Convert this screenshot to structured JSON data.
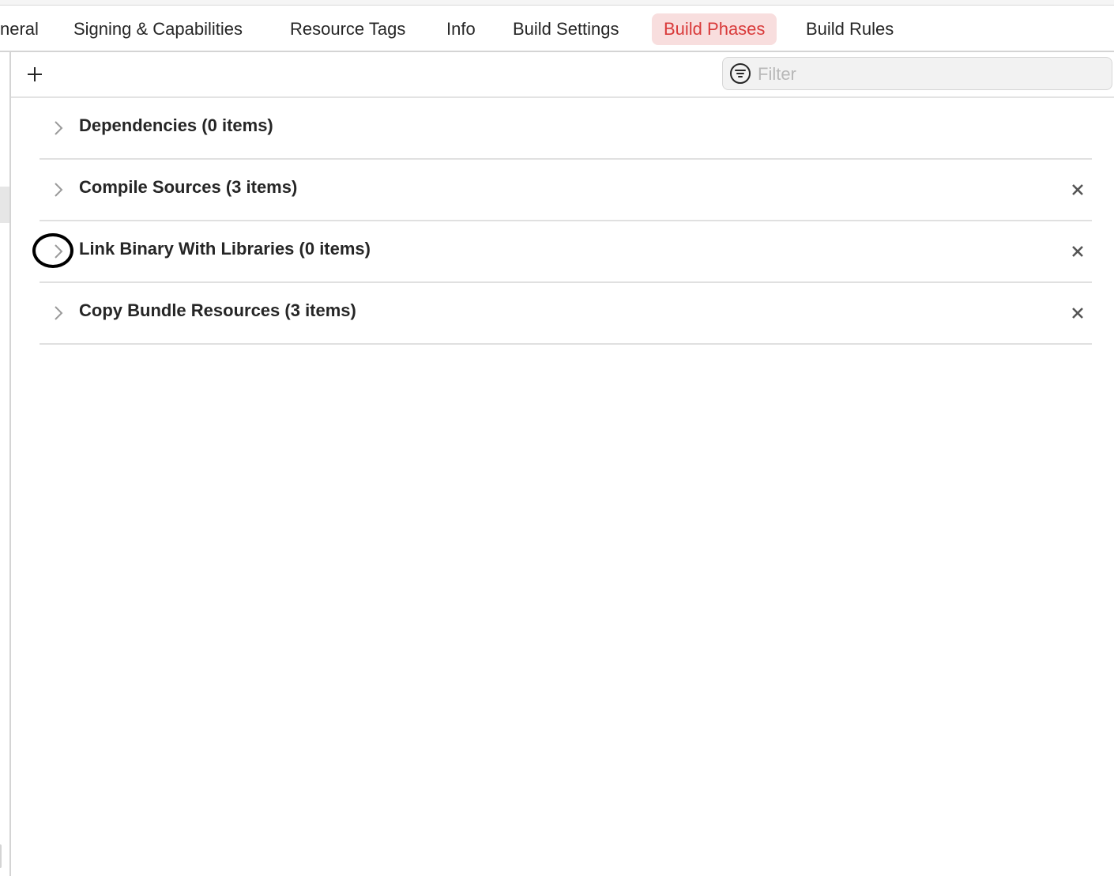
{
  "tabs": [
    {
      "label": "neral",
      "selected": false
    },
    {
      "label": "Signing & Capabilities",
      "selected": false
    },
    {
      "label": "Resource Tags",
      "selected": false
    },
    {
      "label": "Info",
      "selected": false
    },
    {
      "label": "Build Settings",
      "selected": false
    },
    {
      "label": "Build Phases",
      "selected": true
    },
    {
      "label": "Build Rules",
      "selected": false
    }
  ],
  "toolbar": {
    "add_icon": "plus-icon",
    "filter": {
      "placeholder": "Filter",
      "value": "",
      "icon": "filter-icon"
    }
  },
  "phases": [
    {
      "title": "Dependencies (0 items)",
      "deletable": false
    },
    {
      "title": "Compile Sources (3 items)",
      "deletable": true
    },
    {
      "title": "Link Binary With Libraries (0 items)",
      "deletable": true
    },
    {
      "title": "Copy Bundle Resources (3 items)",
      "deletable": true
    }
  ],
  "colors": {
    "accent": "#d93a3a",
    "selected_tab_bg": "#f8dede",
    "text": "#262626",
    "placeholder": "#b8b8b8",
    "divider": "#e0e0e0"
  }
}
